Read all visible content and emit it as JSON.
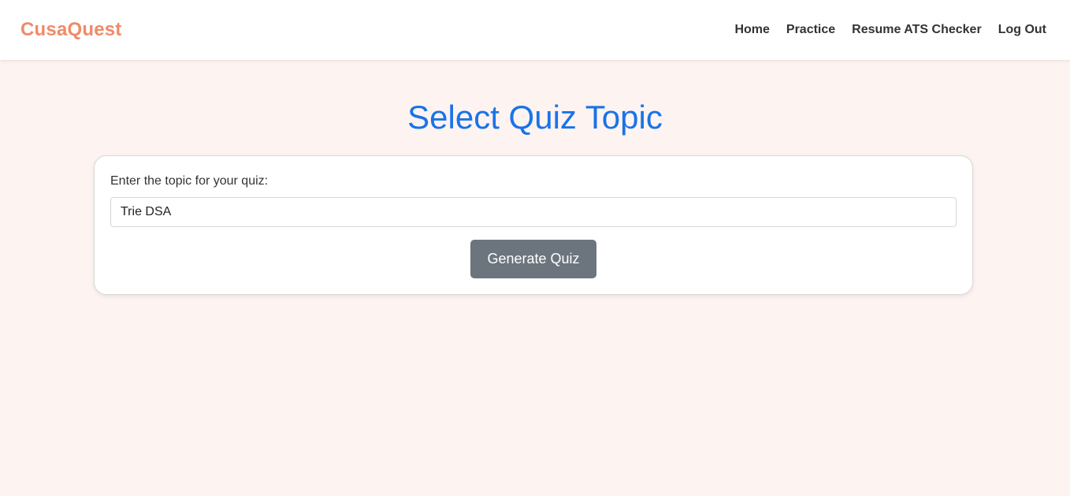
{
  "navbar": {
    "brand": "CusaQuest",
    "links": [
      {
        "label": "Home"
      },
      {
        "label": "Practice"
      },
      {
        "label": "Resume ATS Checker"
      },
      {
        "label": "Log Out"
      }
    ]
  },
  "main": {
    "title": "Select Quiz Topic",
    "form": {
      "label": "Enter the topic for your quiz:",
      "input_value": "Trie DSA",
      "button_label": "Generate Quiz"
    }
  },
  "colors": {
    "brand": "#f08a68",
    "title": "#1a73e8",
    "background": "#fdf3f1",
    "button": "#6c757d"
  }
}
